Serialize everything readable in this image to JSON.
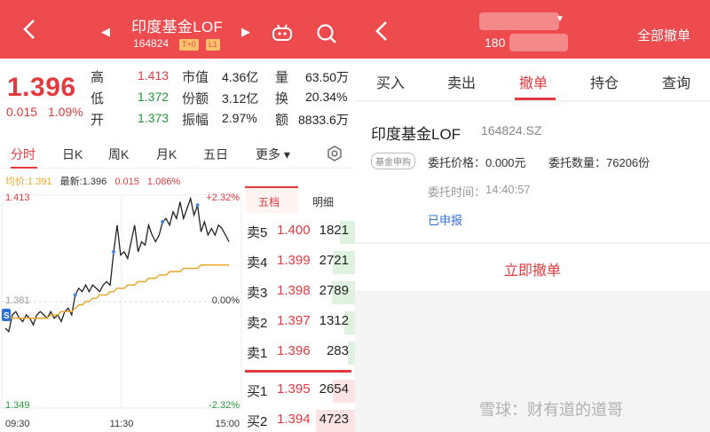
{
  "quote": {
    "header": {
      "title": "印度基金LOF",
      "code": "164824",
      "badge_t0": "T+0",
      "badge_l1": "L1",
      "prev": "◀",
      "next": "▶"
    },
    "price": "1.396",
    "change": "0.015",
    "change_pct": "1.09%",
    "stats": [
      {
        "l1": "高",
        "v1": "1.413",
        "l2": "市值",
        "v2": "4.36亿",
        "l3": "量",
        "v3": "63.50万"
      },
      {
        "l1": "低",
        "v1": "1.372",
        "l2": "份额",
        "v2": "3.12亿",
        "l3": "换",
        "v3": "20.34%"
      },
      {
        "l1": "开",
        "v1": "1.373",
        "l2": "振幅",
        "v2": "2.97%",
        "l3": "额",
        "v3": "8833.6万"
      }
    ],
    "tabs": [
      "分时",
      "日K",
      "周K",
      "月K",
      "五日",
      "更多 ▾"
    ],
    "info": {
      "avg": "均价:1.391",
      "latest": "最新:1.396",
      "chg": "0.015",
      "pct": "1.086%"
    },
    "orderbook": {
      "tab_active": "五档",
      "tab_other": "明细",
      "asks": [
        {
          "label": "卖5",
          "price": "1.400",
          "vol": "1821"
        },
        {
          "label": "卖4",
          "price": "1.399",
          "vol": "2721"
        },
        {
          "label": "卖3",
          "price": "1.398",
          "vol": "2789"
        },
        {
          "label": "卖2",
          "price": "1.397",
          "vol": "1312"
        },
        {
          "label": "卖1",
          "price": "1.396",
          "vol": "283"
        }
      ],
      "bids": [
        {
          "label": "买1",
          "price": "1.395",
          "vol": "2654"
        },
        {
          "label": "买2",
          "price": "1.394",
          "vol": "4723"
        }
      ]
    }
  },
  "chart_data": {
    "type": "line",
    "title": "",
    "xlabel": "",
    "ylabel": "",
    "ylim": [
      1.349,
      1.413
    ],
    "ytick_left": [
      "1.413",
      "1.381",
      "1.349"
    ],
    "ytick_right": [
      "+2.32%",
      "0.00%",
      "-2.32%"
    ],
    "xticks": [
      "09:30",
      "11:30",
      "15:00"
    ],
    "series": [
      {
        "color": "#222222",
        "values": [
          1.373,
          1.372,
          1.377,
          1.378,
          1.376,
          1.375,
          1.377,
          1.376,
          1.374,
          1.377,
          1.378,
          1.377,
          1.376,
          1.378,
          1.376,
          1.377,
          1.375,
          1.378,
          1.379,
          1.377,
          1.383,
          1.385,
          1.384,
          1.386,
          1.384,
          1.386,
          1.385,
          1.384,
          1.386,
          1.387,
          1.386,
          1.396,
          1.404,
          1.395,
          1.396,
          1.394,
          1.399,
          1.404,
          1.396,
          1.399,
          1.398,
          1.404,
          1.401,
          1.399,
          1.401,
          1.405,
          1.406,
          1.404,
          1.408,
          1.406,
          1.411,
          1.406,
          1.409,
          1.412,
          1.407,
          1.41,
          1.402,
          1.405,
          1.401,
          1.403,
          1.401,
          1.404,
          1.403,
          1.401,
          1.399
        ]
      },
      {
        "color": "#e8a82c",
        "values": [
          1.376,
          1.376,
          1.376,
          1.376,
          1.376,
          1.376,
          1.376,
          1.376,
          1.376,
          1.376,
          1.376,
          1.376,
          1.376,
          1.377,
          1.377,
          1.377,
          1.378,
          1.378,
          1.378,
          1.378,
          1.379,
          1.38,
          1.38,
          1.381,
          1.381,
          1.382,
          1.382,
          1.383,
          1.383,
          1.383,
          1.384,
          1.384,
          1.385,
          1.385,
          1.385,
          1.386,
          1.386,
          1.386,
          1.387,
          1.387,
          1.387,
          1.388,
          1.388,
          1.388,
          1.389,
          1.389,
          1.389,
          1.39,
          1.39,
          1.39,
          1.39,
          1.391,
          1.391,
          1.391,
          1.391,
          1.391,
          1.392,
          1.392,
          1.392,
          1.392,
          1.392,
          1.392,
          1.392,
          1.392,
          1.392
        ]
      }
    ]
  },
  "orders": {
    "header": {
      "account": "180",
      "cancel_all": "全部撤单"
    },
    "tabs": [
      "买入",
      "卖出",
      "撤单",
      "持仓",
      "查询"
    ],
    "item": {
      "name": "印度基金LOF",
      "code": "164824.SZ",
      "tag": "基金申购",
      "price_label": "委托价格：",
      "price": "0.000元",
      "qty_label": "委托数量：",
      "qty": "76206份",
      "time_label": "委托时间：",
      "time": "14:40:57",
      "status": "已申报"
    },
    "cancel_button": "立即撤单"
  },
  "watermark": "雪球：财有道的道哥",
  "colors": {
    "brand_red": "#ee4b4f",
    "up": "#e23a3e",
    "down": "#1f9a3a",
    "avg_line": "#e8a82c",
    "link_blue": "#2e6fd6"
  }
}
